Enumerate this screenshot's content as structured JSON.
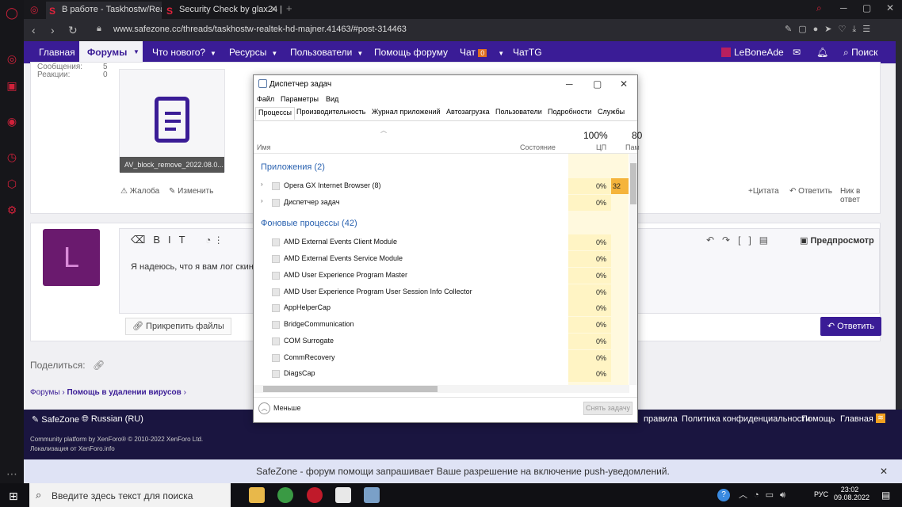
{
  "browser": {
    "tabs": [
      {
        "label": "В работе - Taskhostw/Realt",
        "active": true
      },
      {
        "label": "Security Check by glax24 |",
        "active": false
      }
    ],
    "url": "www.safezone.cc/threads/taskhostw-realtek-hd-majner.41463/#post-314463",
    "icons": [
      "opera-logo-icon",
      "back-icon",
      "forward-icon",
      "reload-icon",
      "lock-icon",
      "search-icon",
      "minimize-icon",
      "maximize-icon",
      "close-icon"
    ]
  },
  "site": {
    "nav": {
      "home": "Главная",
      "forums": "Форумы",
      "whats_new": "Что нового?",
      "resources": "Ресурсы",
      "users": "Пользователи",
      "help": "Помощь форуму",
      "chat": "Чат",
      "chat_badge": "0",
      "chattg": "ЧатTG",
      "user": "LeBoneAde",
      "search": "Поиск"
    },
    "post": {
      "messages_label": "Сообщения:",
      "messages_value": "5",
      "reactions_label": "Реакции:",
      "reactions_value": "0",
      "attachment": "AV_block_remove_2022.08.0...",
      "report": "Жалоба",
      "edit": "Изменить",
      "quote": "+Цитата",
      "reply": "Ответить",
      "no_reply": "Ник в ответ"
    },
    "editor": {
      "avatar_letter": "L",
      "text": "Я надеюсь, что я вам лог скин",
      "preview": "Предпросмотр",
      "attach": "Прикрепить файлы",
      "submit": "Ответить"
    },
    "share": "Поделиться:",
    "breadcrumb": [
      "Форумы",
      "Помощь в удалении вирусов"
    ],
    "footer": {
      "brand": "SafeZone",
      "lang": "Russian (RU)",
      "links": [
        "правила",
        "Политика конфиденциальности",
        "Помощь",
        "Главная"
      ],
      "copyright": "Community platform by XenForo® © 2010-2022 XenForo Ltd.",
      "localization": "Локализация от XenForo.info"
    },
    "push_text": "SafeZone - форум помощи запрашивает Ваше разрешение на включение push-уведомлений."
  },
  "taskmanager": {
    "title": "Диспетчер задач",
    "menu": [
      "Файл",
      "Параметры",
      "Вид"
    ],
    "tabs": [
      "Процессы",
      "Производительность",
      "Журнал приложений",
      "Автозагрузка",
      "Пользователи",
      "Подробности",
      "Службы"
    ],
    "columns": {
      "name": "Имя",
      "status": "Состояние",
      "cpu_pct": "100%",
      "cpu": "ЦП",
      "mem_pct": "80",
      "mem": "Пам"
    },
    "apps_group": "Приложения (2)",
    "apps": [
      {
        "name": "Opera GX Internet Browser (8)",
        "cpu": "0%",
        "mem": "32"
      },
      {
        "name": "Диспетчер задач",
        "cpu": "0%",
        "mem": ""
      }
    ],
    "bg_group": "Фоновые процессы (42)",
    "bg": [
      {
        "name": "AMD External Events Client Module",
        "cpu": "0%"
      },
      {
        "name": "AMD External Events Service Module",
        "cpu": "0%"
      },
      {
        "name": "AMD User Experience Program Master",
        "cpu": "0%"
      },
      {
        "name": "AMD User Experience Program User Session Info Collector",
        "cpu": "0%"
      },
      {
        "name": "AppHelperCap",
        "cpu": "0%"
      },
      {
        "name": "BridgeCommunication",
        "cpu": "0%"
      },
      {
        "name": "COM Surrogate",
        "cpu": "0%"
      },
      {
        "name": "CommRecovery",
        "cpu": "0%"
      },
      {
        "name": "DiagsCap",
        "cpu": "0%"
      }
    ],
    "less": "Меньше",
    "end_task": "Снять задачу"
  },
  "taskbar": {
    "search": "Введите здесь текст для поиска",
    "lang": "РУС",
    "time": "23:02",
    "date": "09.08.2022"
  }
}
